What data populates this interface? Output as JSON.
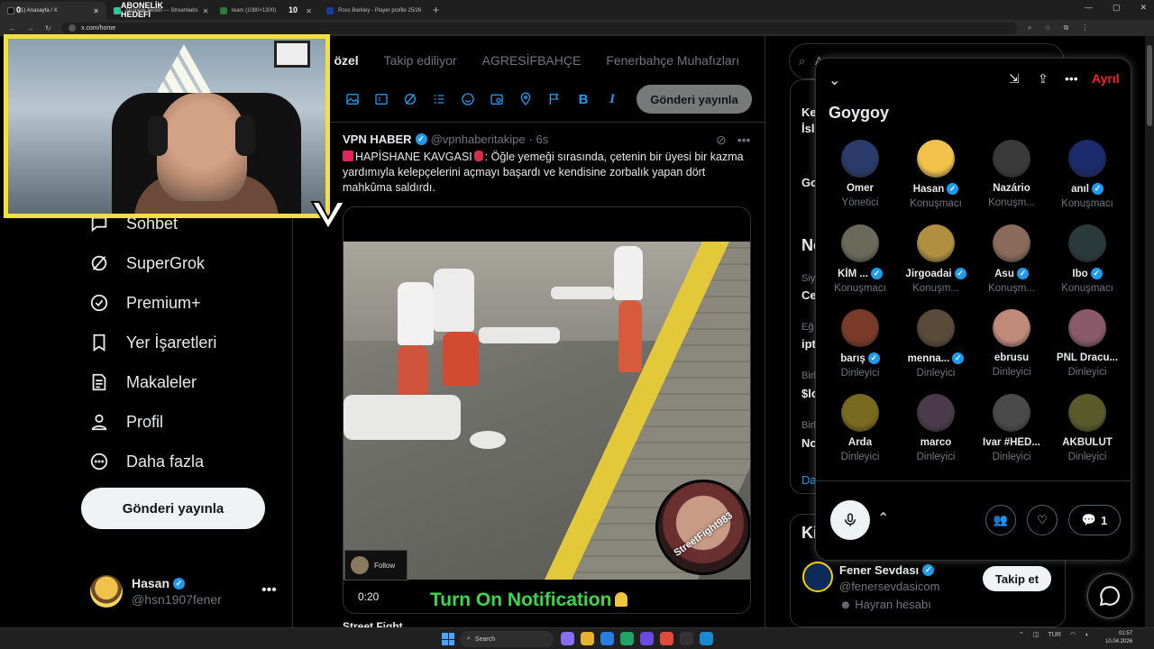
{
  "browser": {
    "tabs": [
      {
        "label": "(1) Anasayfa / X",
        "color": "#111"
      },
      {
        "label": "Abonelik hedefi — Streamlabs",
        "color": "#31c3a2"
      },
      {
        "label": "team (1080×1300)",
        "color": "#2a7a3a"
      },
      {
        "label": "Ross Barkley - Player profile 25/26",
        "color": "#1a3aa0"
      }
    ],
    "url": "x.com/home",
    "window_controls": [
      "—",
      "▢",
      "✕"
    ]
  },
  "overlay": {
    "goal_left": "0",
    "goal_title": "ABONELİK HEDEFİ",
    "goal_right": "10"
  },
  "nav": {
    "items": [
      {
        "label": "Sohbet",
        "icon": "chat-icon"
      },
      {
        "label": "SuperGrok",
        "icon": "grok-icon"
      },
      {
        "label": "Premium+",
        "icon": "premium-icon"
      },
      {
        "label": "Yer İşaretleri",
        "icon": "bookmark-icon"
      },
      {
        "label": "Makaleler",
        "icon": "article-icon"
      },
      {
        "label": "Profil",
        "icon": "profile-icon"
      },
      {
        "label": "Daha fazla",
        "icon": "more-circle-icon"
      }
    ],
    "post_button": "Gönderi yayınla"
  },
  "account": {
    "name": "Hasan",
    "handle": "@hsn1907fener",
    "more": "•••"
  },
  "timeline": {
    "tabs": [
      "n özel",
      "Takip ediliyor",
      "AGRESİFBAHÇE",
      "Fenerbahçe Muhafızları",
      "FE"
    ],
    "composer_post_button": "Gönderi yayınla"
  },
  "tweet": {
    "author": "VPN HABER",
    "handle": "@vpnhaberitakipe",
    "time": "· 6s",
    "text_lead": "HAPİSHANE KAVGASI",
    "text_body": ": Öğle yemeği sırasında, çetenin bir üyesi bir kazma yardımıyla kelepçelerini açmayı başardı ve kendisine zorbalık yapan dört mahkûma saldırdı.",
    "video_time": "0:20",
    "follow_chip": "Follow",
    "watermark": "StreetFight983",
    "notification_text": "Turn On Notification",
    "next_author": "Street Fight"
  },
  "right": {
    "search_placeholder": "A",
    "trend_frags": [
      "Ke",
      "İsl",
      "Go",
      "No",
      "Siy",
      "Ce",
      "Eğ",
      "ipt",
      "Birl",
      "$lo",
      "Birl",
      "No",
      "Da",
      "Ki"
    ],
    "follow_suggestion": {
      "name": "Fener Sevdası",
      "handle": "@fenersevdasicom",
      "note": "Hayran hesabı",
      "button": "Takip et"
    }
  },
  "space": {
    "title": "Goygoy",
    "leave": "Ayrıl",
    "comment_count": "1",
    "participants": [
      {
        "name": "Ömer",
        "role": "Yönetici",
        "verified": false,
        "color": "#2a3a6a"
      },
      {
        "name": "Hasan",
        "role": "Konuşmacı",
        "verified": true,
        "color": "#f1c24a"
      },
      {
        "name": "Nazário",
        "role": "Konuşm...",
        "verified": false,
        "color": "#3a3a3a"
      },
      {
        "name": "anıl",
        "role": "Konuşmacı",
        "verified": true,
        "color": "#1a2a6a"
      },
      {
        "name": "KİM ...",
        "role": "Konuşmacı",
        "verified": true,
        "color": "#6a6a5a"
      },
      {
        "name": "Jirgoadai",
        "role": "Konuşm...",
        "verified": true,
        "color": "#b09040"
      },
      {
        "name": "Asu",
        "role": "Konuşm...",
        "verified": true,
        "color": "#8a6a5a"
      },
      {
        "name": "Ibo",
        "role": "Konuşmacı",
        "verified": true,
        "color": "#2a3a3a"
      },
      {
        "name": "barış",
        "role": "Dinleyici",
        "verified": true,
        "color": "#7a3a2a"
      },
      {
        "name": "menna...",
        "role": "Dinleyici",
        "verified": true,
        "color": "#5a4a3a"
      },
      {
        "name": "ebrusu",
        "role": "Dinleyici",
        "verified": false,
        "color": "#c08a7a"
      },
      {
        "name": "PNL Dracu...",
        "role": "Dinleyici",
        "verified": false,
        "color": "#8a5a6a"
      },
      {
        "name": "Arda",
        "role": "Dinleyici",
        "verified": false,
        "color": "#7a6a20"
      },
      {
        "name": "marco",
        "role": "Dinleyici",
        "verified": false,
        "color": "#4a3a4a"
      },
      {
        "name": "İvar #HED...",
        "role": "Dinleyici",
        "verified": false,
        "color": "#4a4a4a"
      },
      {
        "name": "AKBULUT",
        "role": "Dinleyici",
        "verified": false,
        "color": "#5a5a2a"
      }
    ]
  },
  "taskbar": {
    "search": "Search",
    "lang": "TUR",
    "time": "01:57",
    "date": "10.04.2026"
  }
}
